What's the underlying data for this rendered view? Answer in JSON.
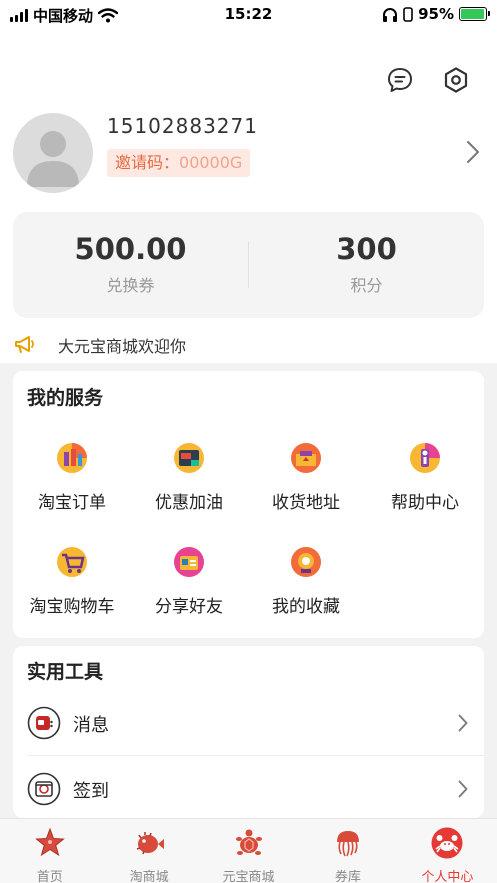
{
  "status_bar": {
    "carrier": "中国移动",
    "time": "15:22",
    "battery": "95%"
  },
  "profile": {
    "phone": "15102883271",
    "invite_label": "邀请码：",
    "invite_code": "00000G"
  },
  "stats": [
    {
      "value": "500.00",
      "label": "兑换券"
    },
    {
      "value": "300",
      "label": "积分"
    }
  ],
  "notice": "大元宝商城欢迎你",
  "services": {
    "title": "我的服务",
    "items": [
      {
        "label": "淘宝订单",
        "icon": "taobao-order-icon"
      },
      {
        "label": "优惠加油",
        "icon": "fuel-discount-icon"
      },
      {
        "label": "收货地址",
        "icon": "shipping-address-icon"
      },
      {
        "label": "帮助中心",
        "icon": "help-center-icon"
      },
      {
        "label": "淘宝购物车",
        "icon": "shopping-cart-icon"
      },
      {
        "label": "分享好友",
        "icon": "share-friends-icon"
      },
      {
        "label": "我的收藏",
        "icon": "favorites-icon"
      }
    ]
  },
  "tools": {
    "title": "实用工具",
    "items": [
      {
        "label": "消息",
        "icon": "message-icon"
      },
      {
        "label": "签到",
        "icon": "checkin-icon"
      }
    ]
  },
  "tabbar": {
    "items": [
      {
        "label": "首页",
        "icon": "starfish-icon"
      },
      {
        "label": "淘商城",
        "icon": "pufferfish-icon"
      },
      {
        "label": "元宝商城",
        "icon": "turtle-icon"
      },
      {
        "label": "券库",
        "icon": "jellyfish-icon"
      },
      {
        "label": "个人中心",
        "icon": "crab-icon"
      }
    ],
    "active_index": 4
  },
  "colors": {
    "accent": "#e53935",
    "invite_text": "#e76a42",
    "invite_bg": "#fde9e2"
  }
}
